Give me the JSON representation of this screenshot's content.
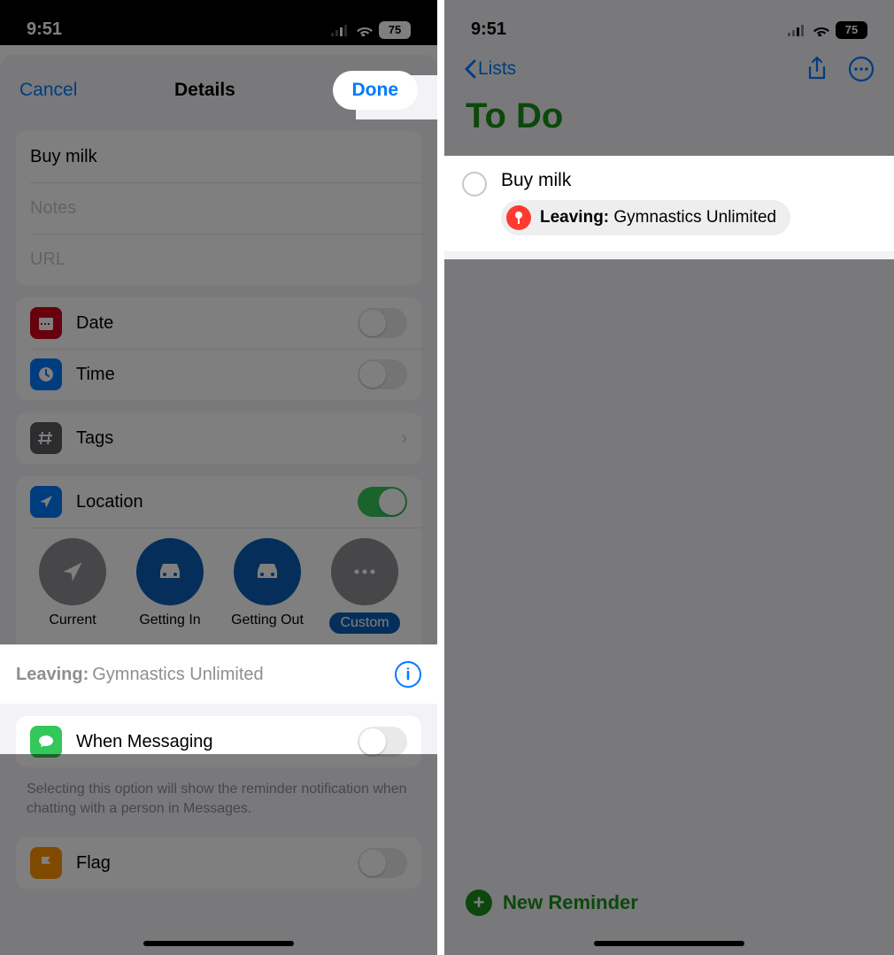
{
  "status": {
    "time": "9:51",
    "battery": "75"
  },
  "left": {
    "header": {
      "cancel": "Cancel",
      "title": "Details",
      "done": "Done"
    },
    "reminder_title": "Buy milk",
    "notes_placeholder": "Notes",
    "url_placeholder": "URL",
    "rows": {
      "date": "Date",
      "time": "Time",
      "tags": "Tags",
      "location": "Location",
      "when_messaging": "When Messaging",
      "flag": "Flag"
    },
    "location_options": {
      "current": "Current",
      "getting_in": "Getting In",
      "getting_out": "Getting Out",
      "custom": "Custom"
    },
    "leaving": {
      "label": "Leaving:",
      "value": "Gymnastics Unlimited"
    },
    "messaging_footnote": "Selecting this option will show the reminder notification when chatting with a person in Messages.",
    "icon_colors": {
      "date": "#d0021b",
      "time": "#007aff",
      "tags": "#5b5b60",
      "location": "#007aff",
      "messaging": "#34c759",
      "flag": "#ff9500"
    }
  },
  "right": {
    "back_label": "Lists",
    "list_title": "To Do",
    "reminder": {
      "title": "Buy milk",
      "cond_label": "Leaving:",
      "cond_value": "Gymnastics Unlimited"
    },
    "new_reminder": "New Reminder"
  }
}
